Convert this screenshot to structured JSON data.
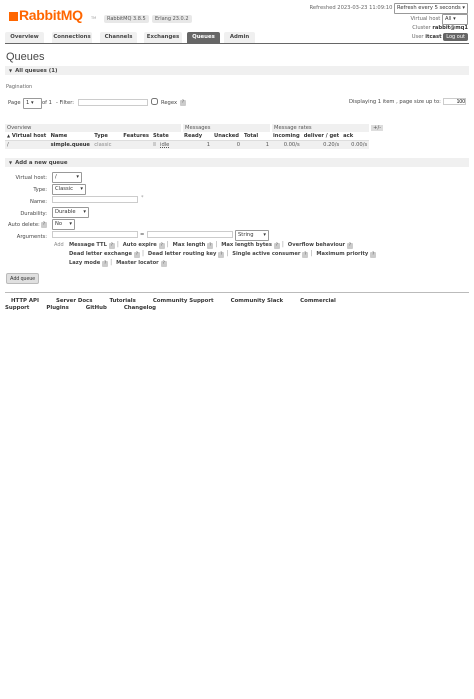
{
  "header": {
    "logo_text": "RabbitMQ",
    "logo_tm": "TM",
    "version_rabbit": "RabbitMQ 3.8.5",
    "version_erlang": "Erlang 23.0.2",
    "refreshed_label": "Refreshed 2023-03-23 11:09:10",
    "refresh_select": "Refresh every 5 seconds",
    "vhost_label": "Virtual host",
    "vhost_select": "All",
    "cluster_label": "Cluster",
    "cluster_value": "rabbit@mq1",
    "user_label": "User",
    "user_value": "itcast",
    "logout_label": "Log out"
  },
  "tabs": [
    "Overview",
    "Connections",
    "Channels",
    "Exchanges",
    "Queues",
    "Admin"
  ],
  "active_tab": "Queues",
  "page_title": "Queues",
  "all_queues_section": "All queues (1)",
  "pagination": {
    "label": "Pagination",
    "page_label": "Page",
    "page_value": "1",
    "of_label": "of 1",
    "filter_label": "- Filter:",
    "regex_label": "Regex",
    "help": "?",
    "displaying": "Displaying 1 item , page size up to:",
    "page_size": "100"
  },
  "table": {
    "group_headers": [
      "Overview",
      "Messages",
      "Message rates",
      "+/-"
    ],
    "columns": [
      "Virtual host",
      "Name",
      "Type",
      "Features",
      "State",
      "Ready",
      "Unacked",
      "Total",
      "incoming",
      "deliver / get",
      "ack"
    ],
    "rows": [
      {
        "vhost": "/",
        "name": "simple.queue",
        "type": "classic",
        "features": "",
        "state": "idle",
        "ready": "1",
        "unacked": "0",
        "total": "1",
        "incoming": "0.00/s",
        "deliver_get": "0.20/s",
        "ack": "0.00/s"
      }
    ]
  },
  "add_queue": {
    "section_title": "Add a new queue",
    "vhost_label": "Virtual host:",
    "vhost_value": "/",
    "type_label": "Type:",
    "type_value": "Classic",
    "name_label": "Name:",
    "name_required": "*",
    "durability_label": "Durability:",
    "durability_value": "Durable",
    "autodelete_label": "Auto delete:",
    "autodelete_help": "?",
    "autodelete_value": "No",
    "arguments_label": "Arguments:",
    "equals": "=",
    "arg_type_value": "String",
    "add_label": "Add",
    "arg_options_row1": [
      "Message TTL",
      "Auto expire",
      "Max length",
      "Max length bytes",
      "Overflow behaviour"
    ],
    "arg_options_row2": [
      "Dead letter exchange",
      "Dead letter routing key",
      "Single active consumer",
      "Maximum priority"
    ],
    "arg_options_row3": [
      "Lazy mode",
      "Master locator"
    ],
    "submit_label": "Add queue"
  },
  "footer": [
    "HTTP API",
    "Server Docs",
    "Tutorials",
    "Community Support",
    "Community Slack",
    "Commercial Support",
    "Plugins",
    "GitHub",
    "Changelog"
  ]
}
